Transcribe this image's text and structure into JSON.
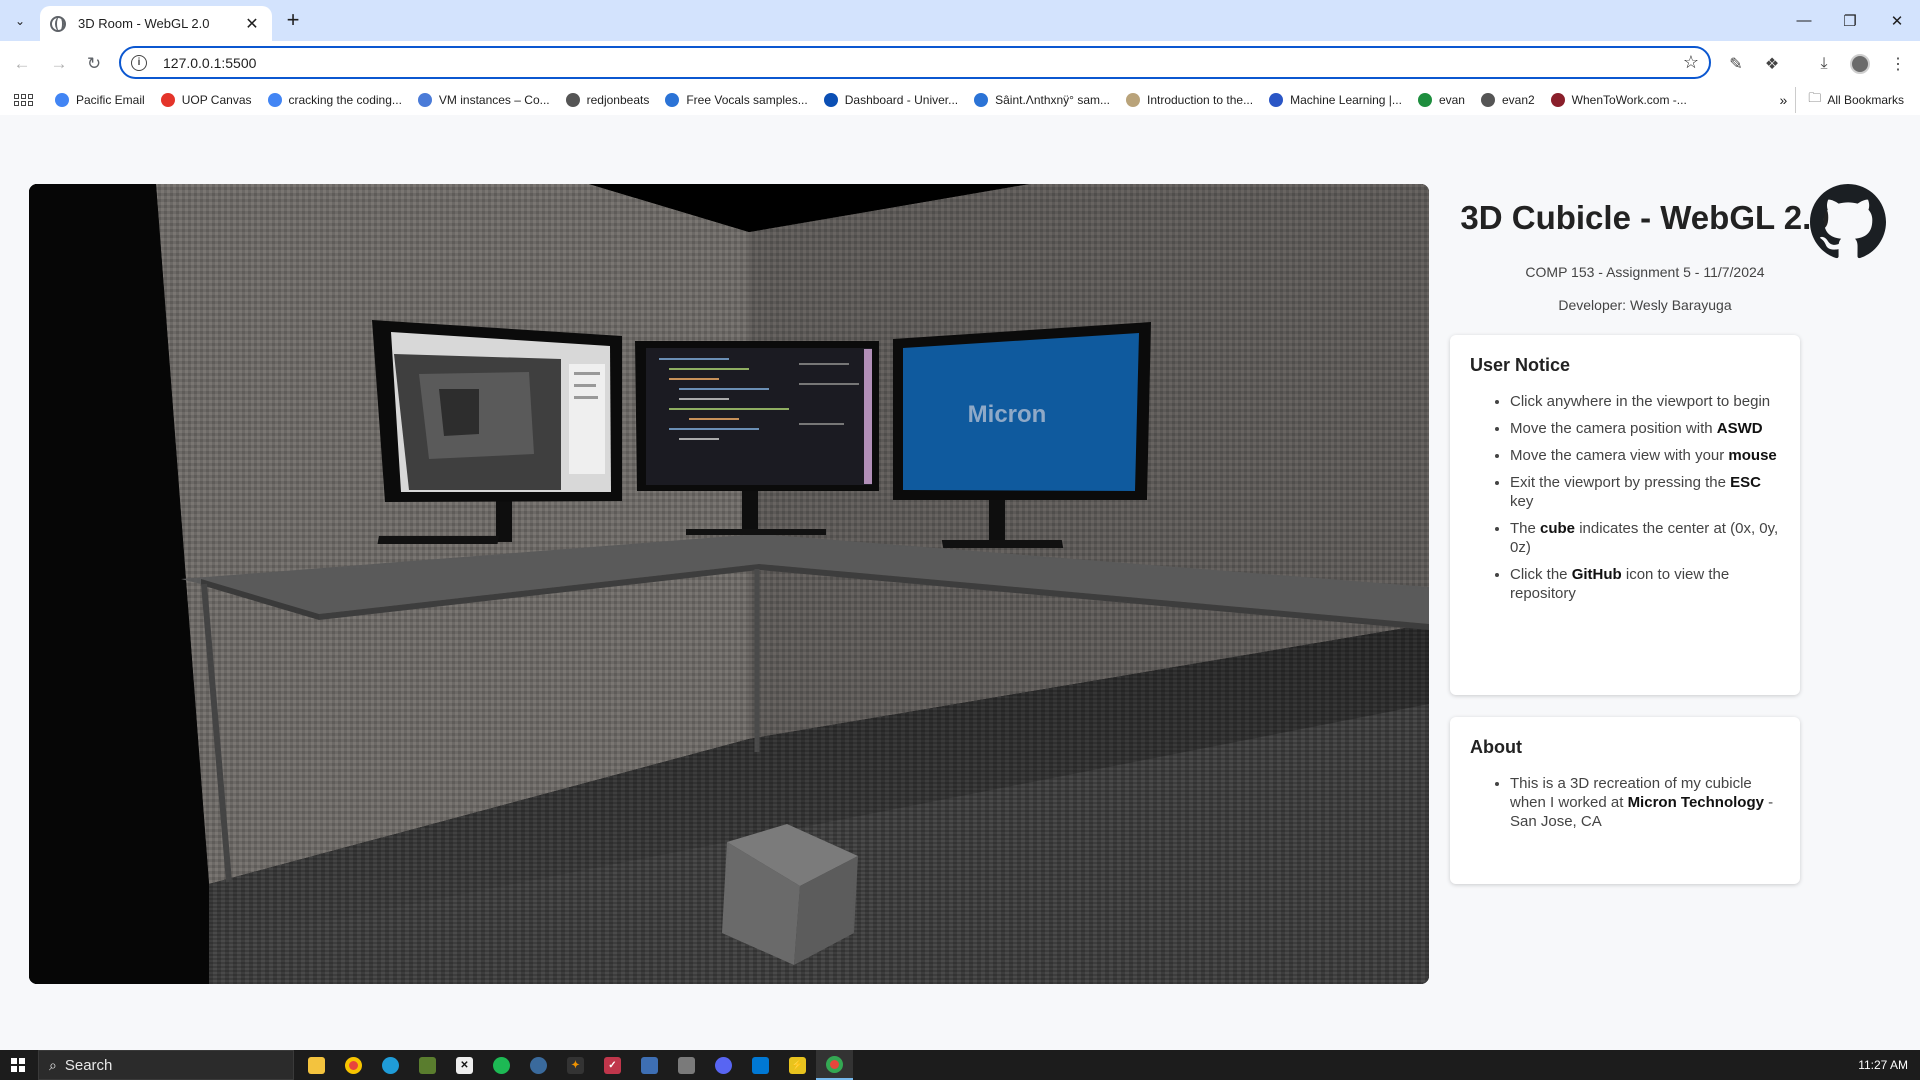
{
  "browser": {
    "tab_title": "3D Room - WebGL 2.0",
    "url": "127.0.0.1:5500",
    "bookmarks": [
      {
        "label": "Pacific Email",
        "icon": "google-icon",
        "color": "#4285f4"
      },
      {
        "label": "UOP Canvas",
        "icon": "canvas-icon",
        "color": "#e4342a"
      },
      {
        "label": "cracking the coding...",
        "icon": "google-icon",
        "color": "#4285f4"
      },
      {
        "label": "VM instances – Co...",
        "icon": "gcp-icon",
        "color": "#4a7bd8"
      },
      {
        "label": "redjonbeats",
        "icon": "web-icon",
        "color": "#555555"
      },
      {
        "label": "Free Vocals samples...",
        "icon": "waveform-icon",
        "color": "#2b73d6"
      },
      {
        "label": "Dashboard - Univer...",
        "icon": "dashboard-icon",
        "color": "#0b4fb4"
      },
      {
        "label": "Sâint.Λnthxnÿ° sam...",
        "icon": "waveform-icon",
        "color": "#2b73d6"
      },
      {
        "label": "Introduction to the...",
        "icon": "doc-icon",
        "color": "#b9a37a"
      },
      {
        "label": "Machine Learning |...",
        "icon": "coursera-icon",
        "color": "#2a56c6"
      },
      {
        "label": "evan",
        "icon": "sheets-icon",
        "color": "#1e8e3e"
      },
      {
        "label": "evan2",
        "icon": "web-icon",
        "color": "#555555"
      },
      {
        "label": "WhenToWork.com -...",
        "icon": "w2w-icon",
        "color": "#8a1f2b"
      }
    ],
    "all_bookmarks": "All Bookmarks"
  },
  "page": {
    "title": "3D Cubicle - WebGL 2.0",
    "course": "COMP 153 - Assignment 5 - 11/7/2024",
    "developer": "Developer: Wesly Barayuga",
    "notice": {
      "heading": "User Notice",
      "items": [
        {
          "pre": "Click anywhere in the viewport to begin",
          "bold": "",
          "post": ""
        },
        {
          "pre": "Move the camera position with ",
          "bold": "ASWD",
          "post": ""
        },
        {
          "pre": "Move the camera view with your ",
          "bold": "mouse",
          "post": ""
        },
        {
          "pre": "Exit the viewport by pressing the ",
          "bold": "ESC",
          "post": " key"
        },
        {
          "pre": "The ",
          "bold": "cube",
          "post": " indicates the center at (0x, 0y, 0z)"
        },
        {
          "pre": "Click the ",
          "bold": "GitHub",
          "post": " icon to view the repository"
        }
      ]
    },
    "about": {
      "heading": "About",
      "pre": "This is a 3D recreation of my cubicle when I worked at ",
      "bold": "Micron Technology",
      "post": " - San Jose, CA"
    },
    "monitor_logo": "Micron"
  },
  "taskbar": {
    "search_placeholder": "Search",
    "time": "11:27 AM"
  }
}
